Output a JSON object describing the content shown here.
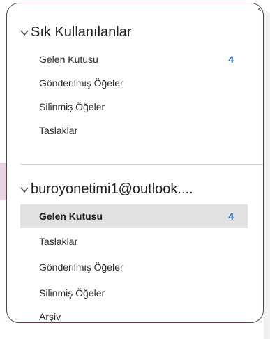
{
  "favorites": {
    "header": "Sık Kullanılanlar",
    "items": [
      {
        "label": "Gelen Kutusu",
        "count": "4"
      },
      {
        "label": "Gönderilmiş Öğeler",
        "count": ""
      },
      {
        "label": "Silinmiş Öğeler",
        "count": ""
      },
      {
        "label": "Taslaklar",
        "count": ""
      }
    ]
  },
  "account": {
    "header": "buroyonetimi1@outlook....",
    "items": [
      {
        "label": "Gelen Kutusu",
        "count": "4",
        "selected": true
      },
      {
        "label": "Taslaklar",
        "count": ""
      },
      {
        "label": "Gönderilmiş Öğeler",
        "count": ""
      },
      {
        "label": "Silinmiş Öğeler",
        "count": ""
      },
      {
        "label": "Arşiv",
        "count": ""
      }
    ]
  },
  "icons": {
    "collapse": "chevron-left-icon",
    "expand": "chevron-down-icon"
  },
  "colors": {
    "border": "#5a3d52",
    "count": "#2067b8",
    "selected_bg": "#e1e1e1"
  }
}
